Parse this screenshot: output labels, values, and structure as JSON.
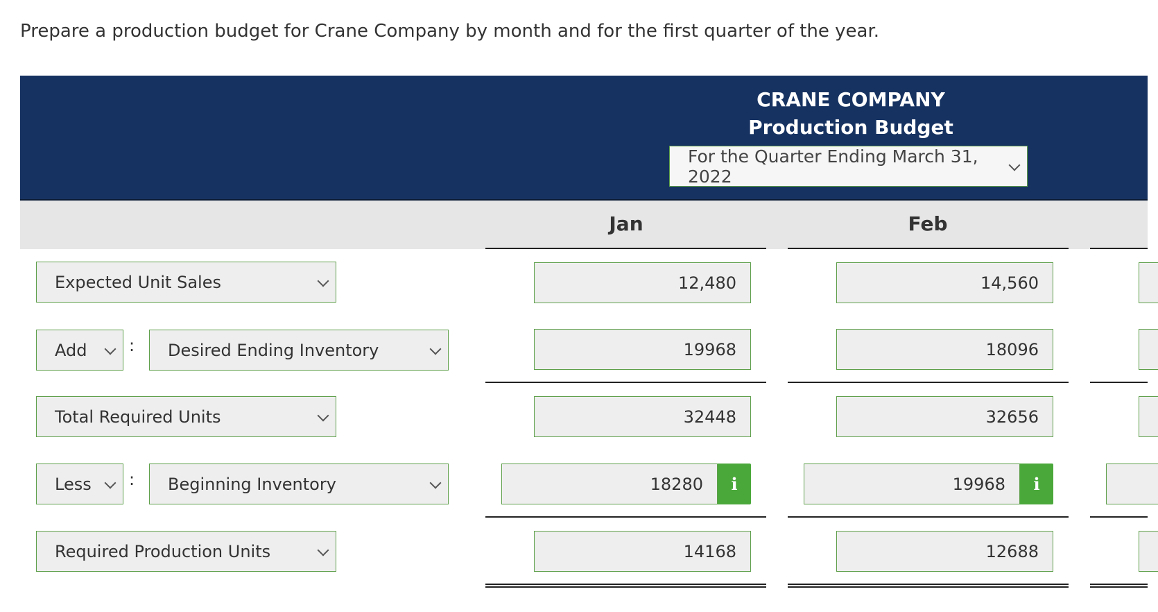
{
  "instruction": "Prepare a production budget for Crane Company by month and for the first quarter of the year.",
  "header": {
    "company": "CRANE COMPANY",
    "title": "Production Budget",
    "period": "For the Quarter Ending March 31, 2022"
  },
  "columns": [
    "Jan",
    "Feb"
  ],
  "rows": {
    "expected_unit_sales": {
      "label": "Expected Unit Sales",
      "jan": "12,480",
      "feb": "14,560"
    },
    "desired_ending": {
      "op": "Add",
      "label": "Desired Ending Inventory",
      "jan": "19968",
      "feb": "18096"
    },
    "total_required": {
      "label": "Total Required Units",
      "jan": "32448",
      "feb": "32656"
    },
    "beginning_inventory": {
      "op": "Less",
      "label": "Beginning Inventory",
      "jan": "18280",
      "feb": "19968"
    },
    "required_production": {
      "label": "Required Production Units",
      "jan": "14168",
      "feb": "12688"
    }
  },
  "info_icon_glyph": "i",
  "colors": {
    "header_bg": "#163261",
    "accent_green": "#4aa83a",
    "field_bg": "#eeeeee"
  }
}
